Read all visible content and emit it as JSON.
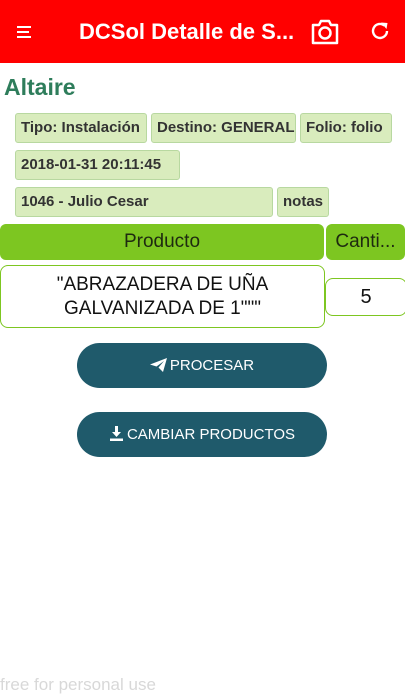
{
  "appbar": {
    "title": "DCSol Detalle de S...",
    "menu_icon": "menu-icon",
    "camera_icon": "camera-icon",
    "refresh_icon": "refresh-icon"
  },
  "project": "Altaire",
  "tags": {
    "tipo": "Tipo: Instalación",
    "destino": "Destino: GENERAL",
    "folio": "Folio: folio",
    "fecha": "2018-01-31 20:11:45",
    "cliente": "1046 - Julio Cesar",
    "notas": "notas"
  },
  "table": {
    "headers": [
      "Producto",
      "Canti..."
    ],
    "rows": [
      {
        "producto": "\"ABRAZADERA DE UÑA GALVANIZADA DE 1\"\"\"",
        "cantidad": "5"
      }
    ]
  },
  "buttons": {
    "procesar": "PROCESAR",
    "cambiar": "CAMBIAR PRODUCTOS"
  },
  "watermark": "free for personal use",
  "colors": {
    "appbar": "#ff0000",
    "header": "#7dc621",
    "tag": "#d9ecbd",
    "button": "#1f5a6b",
    "project": "#2e7d5b"
  }
}
